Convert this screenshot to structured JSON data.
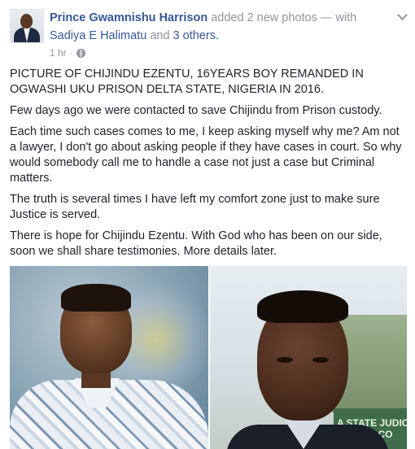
{
  "header": {
    "author": "Prince Gwamnishu Harrison",
    "action": "added 2 new photos — with",
    "tagged_person": "Sadiya E Halimatu",
    "and_text": "and",
    "others": "3 others.",
    "timestamp": "1 hr",
    "separator": "·"
  },
  "icons": {
    "privacy": "globe-icon",
    "menu": "chevron-down-icon"
  },
  "post": {
    "paragraphs": [
      "PICTURE OF CHIJINDU EZENTU, 16YEARS BOY REMANDED IN OGWASHI UKU PRISON DELTA STATE, NIGERIA IN 2016.",
      "Few days ago we were contacted to save Chijindu from Prison custody.",
      "Each time such cases comes to me, I keep asking myself why me? Am not a lawyer, I don't go about asking people if they have cases in court. So why would somebody call me to handle a case not just a case but Criminal matters.",
      "The truth is several times I have left my comfort zone just to make sure Justice is served.",
      "There is hope for Chijindu Ezentu. With God who has been on our side, soon we shall share testimonies. More details later."
    ]
  },
  "photos": {
    "photo2_sign_text": "A STATE JUDIC\nSTRATE CO"
  },
  "colors": {
    "link": "#365899",
    "meta": "#90949c",
    "text": "#1d2129"
  }
}
